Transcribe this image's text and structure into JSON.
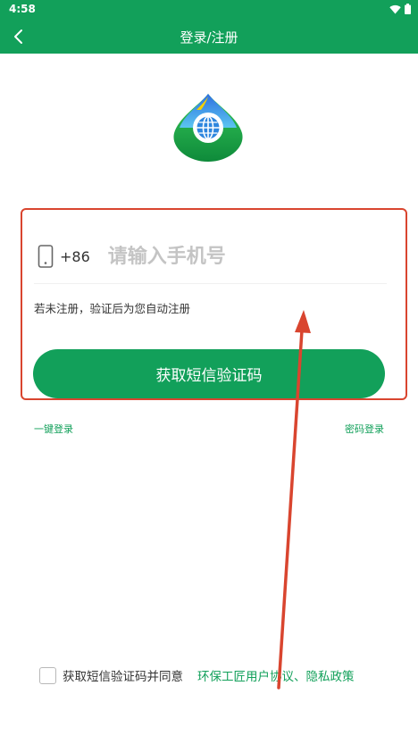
{
  "status_bar": {
    "time": "4:58",
    "icons": [
      "wifi-icon",
      "battery-icon"
    ]
  },
  "app_bar": {
    "back_icon": "back-arrow-icon",
    "title": "登录/注册"
  },
  "logo": {
    "icon": "globe-logo-icon"
  },
  "login_form": {
    "phone_icon": "smartphone-icon",
    "country_code": "+86",
    "phone_placeholder": "请输入手机号",
    "phone_value": "",
    "hint": "若未注册，验证后为您自动注册",
    "sms_button_label": "获取短信验证码"
  },
  "links": {
    "one_click_login": "一键登录",
    "password_login": "密码登录"
  },
  "agreement": {
    "checked": false,
    "text": "获取短信验证码并同意",
    "policy_link": "环保工匠用户协议、隐私政策"
  },
  "colors": {
    "brand_green": "#12a05a",
    "annotation_red": "#d9452f",
    "placeholder_gray": "#c4c4c4"
  }
}
